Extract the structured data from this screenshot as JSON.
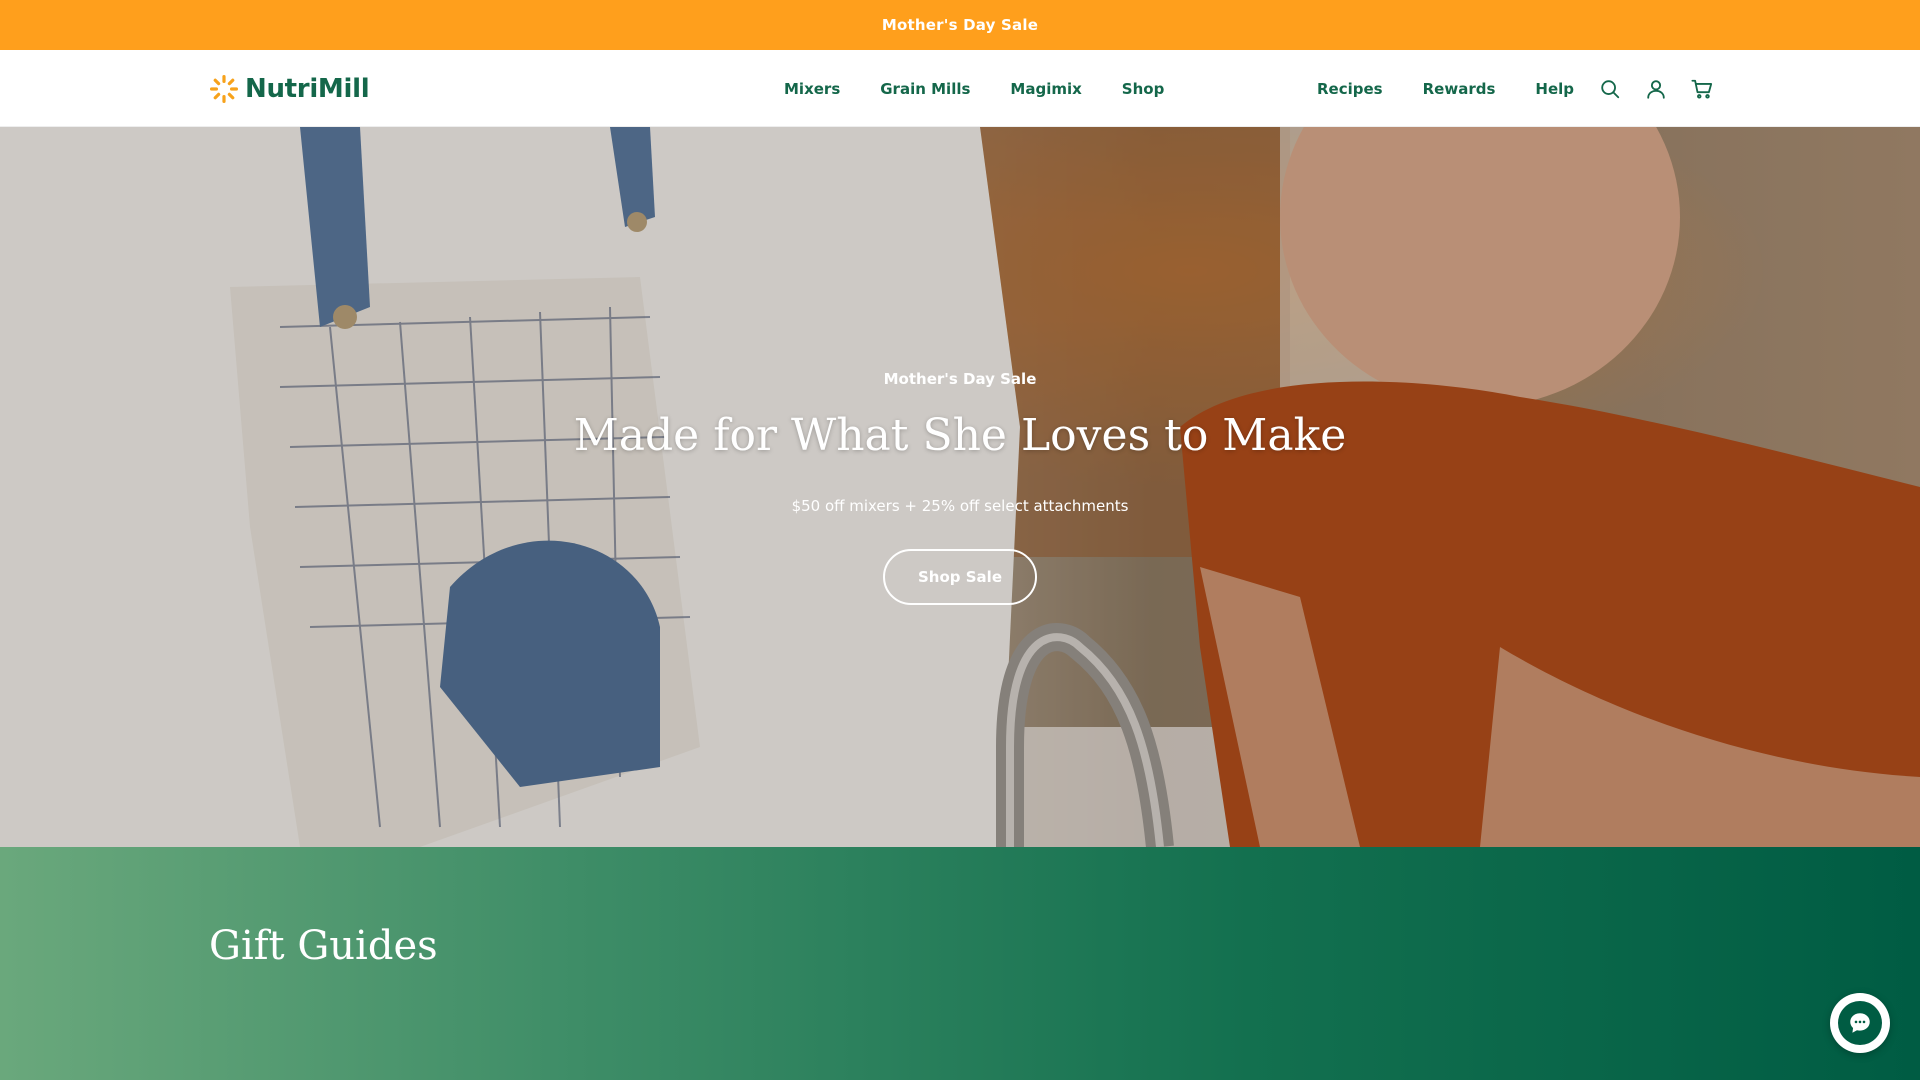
{
  "announcement": {
    "text": "Mother's Day Sale"
  },
  "header": {
    "logo_text": "NutriMill",
    "nav_left": [
      "Mixers",
      "Grain Mills",
      "Magimix",
      "Shop"
    ],
    "nav_right": [
      "Recipes",
      "Rewards",
      "Help"
    ],
    "icons": [
      "search-icon",
      "account-icon",
      "cart-icon"
    ]
  },
  "hero": {
    "eyebrow": "Mother's Day Sale",
    "title": "Made for What She Loves to Make",
    "subtitle": "$50 off mixers + 25% off select attachments",
    "cta": "Shop Sale"
  },
  "gift_guides": {
    "title": "Gift Guides"
  },
  "chat": {
    "icon": "chat-bubble-icon"
  },
  "colors": {
    "announcement_bg": "#ff9f1c",
    "brand_green": "#14674a",
    "gift_gradient_start": "#6aa87c",
    "gift_gradient_end": "#005c43"
  }
}
